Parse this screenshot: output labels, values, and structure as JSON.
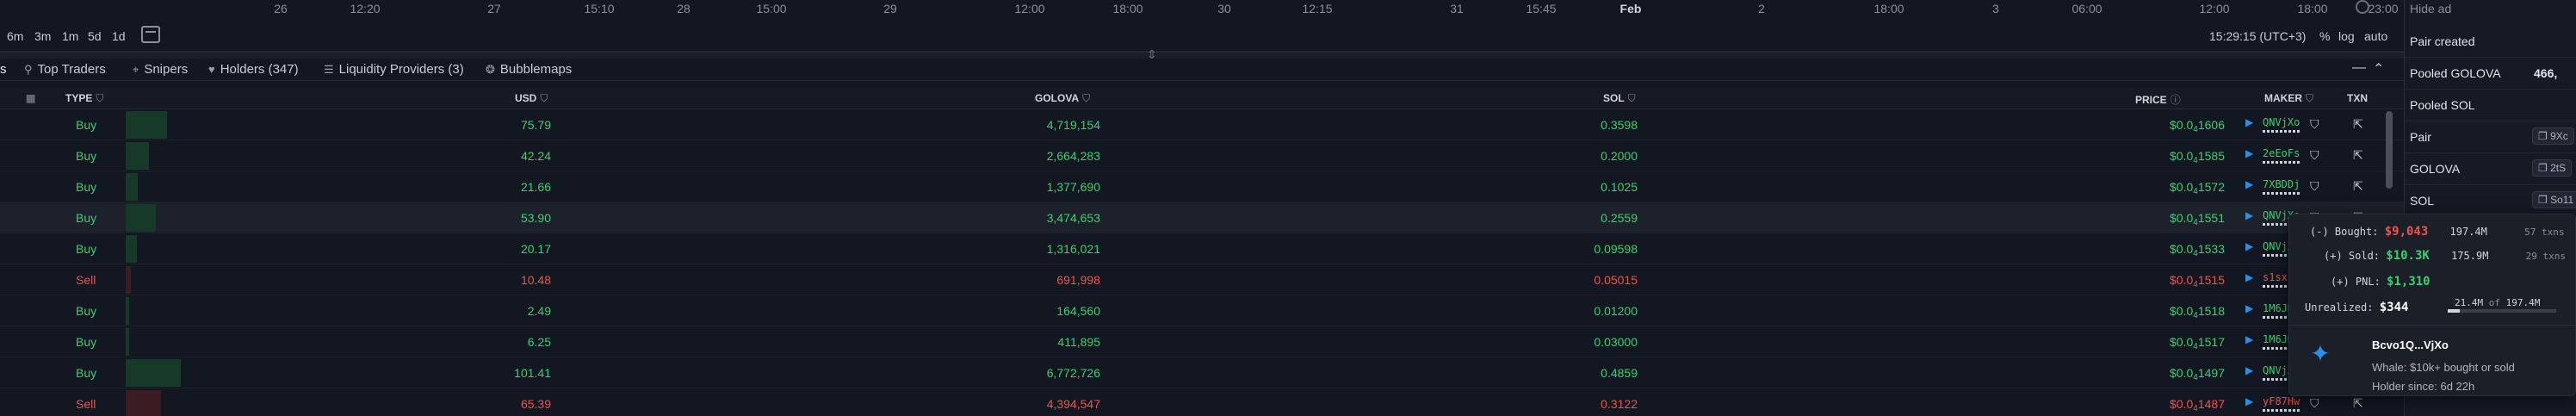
{
  "time_axis": {
    "labels": [
      "26",
      "12:20",
      "27",
      "15:10",
      "28",
      "15:00",
      "29",
      "12:00",
      "18:00",
      "30",
      "12:15",
      "31",
      "15:45",
      "Feb",
      "2",
      "18:00",
      "3",
      "06:00",
      "12:00",
      "18:00",
      "23:00"
    ]
  },
  "range_bar": {
    "ranges": [
      "6m",
      "3m",
      "1m",
      "5d",
      "1d"
    ],
    "clock": "15:29:15 (UTC+3)",
    "percent": "%",
    "log": "log",
    "auto": "auto"
  },
  "tabs": [
    {
      "label": "s",
      "icon": ""
    },
    {
      "label": "Top Traders",
      "icon": "trophy-icon"
    },
    {
      "label": "Snipers",
      "icon": "crosshair-icon"
    },
    {
      "label": "Holders (347)",
      "icon": "heart-icon"
    },
    {
      "label": "Liquidity Providers (3)",
      "icon": "list-icon"
    },
    {
      "label": "Bubblemaps",
      "icon": "bubbles-icon"
    }
  ],
  "table": {
    "headers": {
      "type": "TYPE",
      "usd": "USD",
      "golova": "GOLOVA",
      "sol": "SOL",
      "price": "PRICE",
      "maker": "MAKER",
      "txn": "TXN"
    },
    "rows": [
      {
        "type": "Buy",
        "usd": "75.79",
        "golova": "4,719,154",
        "sol": "0.3598",
        "price_pre": "$0.0",
        "price_sub": "4",
        "price_post": "1606",
        "maker": "QNVjXo",
        "size": 0.75
      },
      {
        "type": "Buy",
        "usd": "42.24",
        "golova": "2,664,283",
        "sol": "0.2000",
        "price_pre": "$0.0",
        "price_sub": "4",
        "price_post": "1585",
        "maker": "2eEoFs",
        "size": 0.42
      },
      {
        "type": "Buy",
        "usd": "21.66",
        "golova": "1,377,690",
        "sol": "0.1025",
        "price_pre": "$0.0",
        "price_sub": "4",
        "price_post": "1572",
        "maker": "7XBDDj",
        "size": 0.22
      },
      {
        "type": "Buy",
        "usd": "53.90",
        "golova": "3,474,653",
        "sol": "0.2559",
        "price_pre": "$0.0",
        "price_sub": "4",
        "price_post": "1551",
        "maker": "QNVjXo",
        "size": 0.54
      },
      {
        "type": "Buy",
        "usd": "20.17",
        "golova": "1,316,021",
        "sol": "0.09598",
        "price_pre": "$0.0",
        "price_sub": "4",
        "price_post": "1533",
        "maker": "QNVjXo",
        "size": 0.2
      },
      {
        "type": "Sell",
        "usd": "10.48",
        "golova": "691,998",
        "sol": "0.05015",
        "price_pre": "$0.0",
        "price_sub": "4",
        "price_post": "1515",
        "maker": "s1sxkh",
        "size": 0.1
      },
      {
        "type": "Buy",
        "usd": "2.49",
        "golova": "164,560",
        "sol": "0.01200",
        "price_pre": "$0.0",
        "price_sub": "4",
        "price_post": "1518",
        "maker": "1M6JKW",
        "size": 0.03
      },
      {
        "type": "Buy",
        "usd": "6.25",
        "golova": "411,895",
        "sol": "0.03000",
        "price_pre": "$0.0",
        "price_sub": "4",
        "price_post": "1517",
        "maker": "1M6JKW",
        "size": 0.06
      },
      {
        "type": "Buy",
        "usd": "101.41",
        "golova": "6,772,726",
        "sol": "0.4859",
        "price_pre": "$0.0",
        "price_sub": "4",
        "price_post": "1497",
        "maker": "QNVjXo",
        "size": 1.0
      },
      {
        "type": "Sell",
        "usd": "65.39",
        "golova": "4,394,547",
        "sol": "0.3122",
        "price_pre": "$0.0",
        "price_sub": "4",
        "price_post": "1487",
        "maker": "yF87Hw",
        "size": 0.64
      }
    ]
  },
  "right_panel": {
    "hide_ad": "Hide ad",
    "rows": [
      {
        "label": "Pair created",
        "value": ""
      },
      {
        "label": "Pooled GOLOVA",
        "value": "466,"
      },
      {
        "label": "Pooled SOL",
        "value": ""
      },
      {
        "label": "Pair",
        "pill": "9Xc"
      },
      {
        "label": "GOLOVA",
        "pill": "2tS"
      },
      {
        "label": "SOL",
        "pill": "So11"
      }
    ]
  },
  "popover": {
    "bought_label": "(-) Bought:",
    "bought_value": "$9,043",
    "bought_amount": "197.4M",
    "bought_txns": "57 txns",
    "sold_label": "(+) Sold:",
    "sold_value": "$10.3K",
    "sold_amount": "175.9M",
    "sold_txns": "29 txns",
    "pnl_label": "(+) PNL:",
    "pnl_value": "$1,310",
    "unrealized_label": "Unrealized:",
    "unrealized_value": "$344",
    "holding_now": "21.4M",
    "holding_of": "of",
    "holding_total": "197.4M",
    "holding_fraction": 0.108,
    "address": "Bcvo1Q...VjXo",
    "whale_desc": "Whale: $10k+ bought or sold",
    "holder_since": "Holder since: 6d 22h"
  },
  "colors": {
    "buy": "#3ccf6e",
    "sell": "#f0524d",
    "bg": "#131722"
  }
}
